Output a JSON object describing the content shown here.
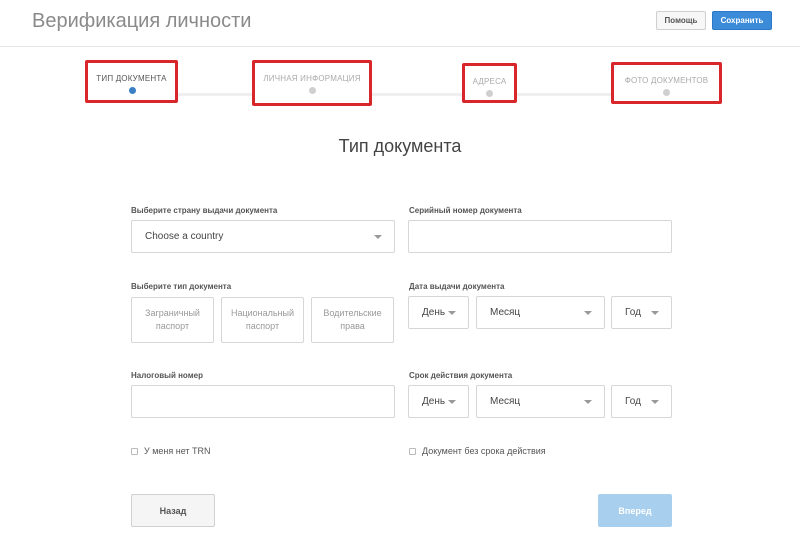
{
  "header": {
    "title": "Верификация личности",
    "help_label": "Помощь",
    "save_label": "Сохранить"
  },
  "steps": [
    {
      "label": "ТИП ДОКУМЕНТА",
      "active": true
    },
    {
      "label": "ЛИЧНАЯ ИНФОРМАЦИЯ",
      "active": false
    },
    {
      "label": "АДРЕСА",
      "active": false
    },
    {
      "label": "ФОТО ДОКУМЕНТОВ",
      "active": false
    }
  ],
  "section_title": "Тип документа",
  "form": {
    "country_label": "Выберите страну выдачи документа",
    "country_value": "Choose a country",
    "serial_label": "Серийный номер документа",
    "serial_value": "",
    "doc_type_label": "Выберите тип документа",
    "doc_types": [
      "Заграничный паспорт",
      "Национальный паспорт",
      "Водительские права"
    ],
    "issue_date_label": "Дата выдачи документа",
    "expiry_label": "Срок действия документа",
    "day_placeholder": "День",
    "month_placeholder": "Месяц",
    "year_placeholder": "Год",
    "tax_label": "Налоговый номер",
    "tax_value": "",
    "no_trn_label": "У меня нет TRN",
    "no_expiry_label": "Документ без срока действия"
  },
  "nav": {
    "back_label": "Назад",
    "next_label": "Вперед"
  },
  "colors": {
    "accent": "#3b8bd9",
    "step_highlight": "#d9262a",
    "next_disabled": "#a9cfee"
  }
}
